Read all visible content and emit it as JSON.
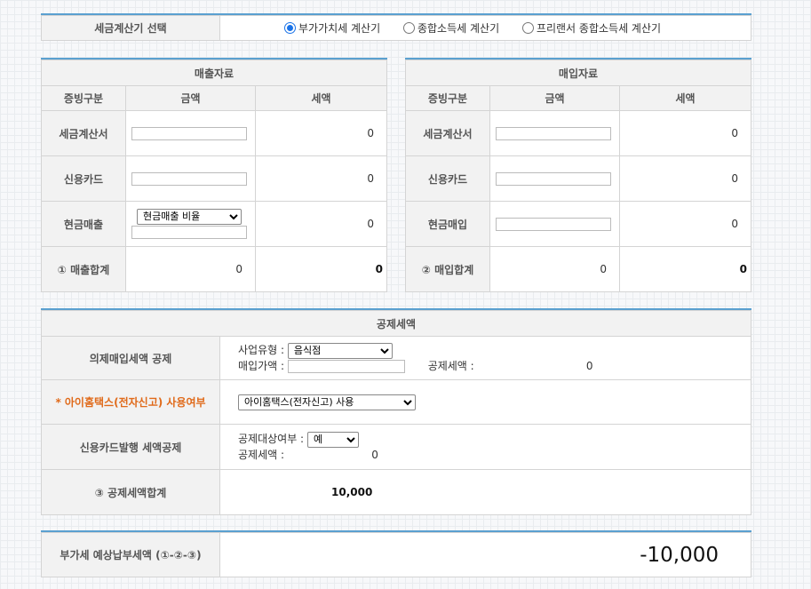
{
  "calc_select": {
    "label": "세금계산기 선택",
    "options": [
      {
        "label": "부가가치세 계산기",
        "checked": true
      },
      {
        "label": "종합소득세 계산기",
        "checked": false
      },
      {
        "label": "프리랜서 종합소득세 계산기",
        "checked": false
      }
    ]
  },
  "sales": {
    "title": "매출자료",
    "col_type": "증빙구분",
    "col_amount": "금액",
    "col_tax": "세액",
    "rows": [
      {
        "label": "세금계산서",
        "tax": "0"
      },
      {
        "label": "신용카드",
        "tax": "0"
      },
      {
        "label": "현금매출",
        "tax": "0",
        "ratio_select": "현금매출 비율"
      }
    ],
    "total": {
      "label": "① 매출합계",
      "amount": "0",
      "tax": "0"
    }
  },
  "purchase": {
    "title": "매입자료",
    "col_type": "증빙구분",
    "col_amount": "금액",
    "col_tax": "세액",
    "rows": [
      {
        "label": "세금계산서",
        "tax": "0"
      },
      {
        "label": "신용카드",
        "tax": "0"
      },
      {
        "label": "현금매입",
        "tax": "0"
      }
    ],
    "total": {
      "label": "② 매입합계",
      "amount": "0",
      "tax": "0"
    }
  },
  "deduction": {
    "title": "공제세액",
    "deemed": {
      "label": "의제매입세액 공제",
      "biz_type_label": "사업유형 :",
      "biz_type_value": "음식점",
      "purchase_label": "매입가액 :",
      "deduct_label": "공제세액 :",
      "deduct_value": "0"
    },
    "hometax": {
      "label": "* 아이홈택스(전자신고) 사용여부",
      "value": "아이홈택스(전자신고) 사용"
    },
    "card": {
      "label": "신용카드발행 세액공제",
      "target_label": "공제대상여부 :",
      "target_value": "예",
      "deduct_label": "공제세액 :",
      "deduct_value": "0"
    },
    "total": {
      "label": "③ 공제세액합계",
      "value": "10,000"
    }
  },
  "result": {
    "label": "부가세 예상납부세액 (①-②-③)",
    "value": "-10,000"
  },
  "colors": {
    "accent": "#5aa0d0",
    "warning": "#e06a1a",
    "radio": "#1a73e8"
  }
}
